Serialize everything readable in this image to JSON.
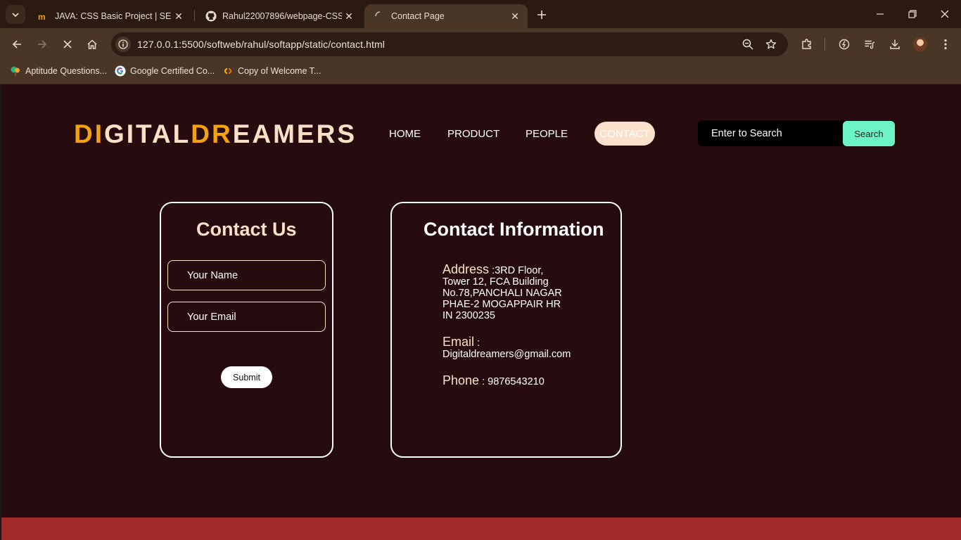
{
  "browser": {
    "tabs": [
      {
        "title": "JAVA: CSS Basic Project | SEC",
        "active": false
      },
      {
        "title": "Rahul22007896/webpage-CSS-",
        "active": false
      },
      {
        "title": "Contact Page",
        "active": true
      }
    ],
    "url": "127.0.0.1:5500/softweb/rahul/softapp/static/contact.html",
    "bookmarks": [
      {
        "label": "Aptitude Questions..."
      },
      {
        "label": "Google Certified Co..."
      },
      {
        "label": "Copy of Welcome T..."
      }
    ]
  },
  "site": {
    "logo": {
      "part1_accent": "DI",
      "part1_rest": "GITAL",
      "part2_accent": "DR",
      "part2_rest": "EAMERS"
    },
    "nav": {
      "home": "HOME",
      "product": "PRODUCT",
      "people": "PEOPLE",
      "contact": "CONTACT"
    },
    "search": {
      "placeholder": "Enter to Search",
      "button": "Search"
    }
  },
  "contact_form": {
    "title": "Contact Us",
    "name_placeholder": "Your Name",
    "email_placeholder": "Your Email",
    "submit": "Submit"
  },
  "contact_info": {
    "title": "Contact Information",
    "address_label": "Address",
    "address_sep": " :",
    "address_lines": [
      "3RD Floor,",
      "Tower 12, FCA Building",
      "No.78,PANCHALI NAGAR",
      "PHAE-2 MOGAPPAIR HR",
      "IN 2300235"
    ],
    "email_label": "Email",
    "email_sep": " :",
    "email": "Digitaldreamers@gmail.com",
    "phone_label": "Phone",
    "phone_sep": " : ",
    "phone": "9876543210"
  },
  "colors": {
    "page_bg": "#260c0e",
    "logo_accent": "#f4a20f",
    "logo_text": "#fbe0c8",
    "search_button": "#6cf3c8",
    "footer": "#a32a2a"
  }
}
